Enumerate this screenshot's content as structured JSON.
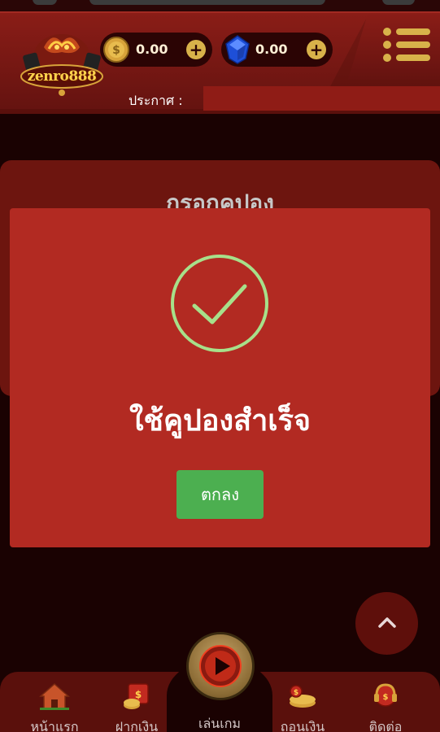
{
  "header": {
    "logo_text": "zenro888",
    "coin_balance": "0.00",
    "gem_balance": "0.00",
    "announcement_label": "ประกาศ :"
  },
  "coupon": {
    "title": "กรอกคูปอง"
  },
  "modal": {
    "message": "ใช้คูปองสำเร็จ",
    "ok_label": "ตกลง"
  },
  "bottom_nav": {
    "items": [
      {
        "label": "หน้าแรก",
        "icon": "home-icon"
      },
      {
        "label": "ฝากเงิน",
        "icon": "deposit-icon"
      },
      {
        "label": "เล่นเกม",
        "icon": "play-icon"
      },
      {
        "label": "ถอนเงิน",
        "icon": "withdraw-icon"
      },
      {
        "label": "ติดต่อ",
        "icon": "contact-icon"
      }
    ]
  },
  "colors": {
    "modal_bg": "#b22a22",
    "ok_button": "#4caf50",
    "check": "#a7e08a",
    "gold": "#d8b24a"
  }
}
